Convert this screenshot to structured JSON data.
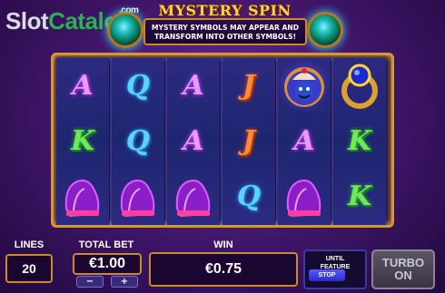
{
  "watermark": {
    "part1": "Slot",
    "part2": "Catalog",
    "suffix": ".com"
  },
  "header": {
    "title": "MYSTERY SPIN",
    "banner_line1": "MYSTERY SYMBOLS MAY APPEAR AND",
    "banner_line2": "TRANSFORM INTO OTHER SYMBOLS!"
  },
  "reels": [
    [
      {
        "t": "A",
        "c": "a"
      },
      {
        "t": "K",
        "c": "k"
      },
      {
        "t": "",
        "c": "scroll"
      }
    ],
    [
      {
        "t": "Q",
        "c": "q"
      },
      {
        "t": "Q",
        "c": "q"
      },
      {
        "t": "",
        "c": "scroll"
      }
    ],
    [
      {
        "t": "A",
        "c": "a"
      },
      {
        "t": "A",
        "c": "a"
      },
      {
        "t": "",
        "c": "scroll"
      }
    ],
    [
      {
        "t": "J",
        "c": "j"
      },
      {
        "t": "J",
        "c": "j"
      },
      {
        "t": "Q",
        "c": "q"
      }
    ],
    [
      {
        "t": "",
        "c": "genie"
      },
      {
        "t": "A",
        "c": "a"
      },
      {
        "t": "",
        "c": "scroll"
      }
    ],
    [
      {
        "t": "",
        "c": "ring"
      },
      {
        "t": "K",
        "c": "k"
      },
      {
        "t": "K",
        "c": "k"
      }
    ]
  ],
  "bottom": {
    "lines_label": "LINES",
    "lines_value": "20",
    "bet_label": "TOTAL BET",
    "bet_value": "€1.00",
    "minus": "−",
    "plus": "+",
    "win_label": "WIN",
    "win_value": "€0.75",
    "until_line1": "UNTIL",
    "until_line2": "FEATURE",
    "stop_label": "STOP",
    "turbo_line1": "TURBO",
    "turbo_line2": "ON"
  },
  "colors": {
    "frame": "#d8962e",
    "background": "#3d1466",
    "accent_gold": "#ffd23a"
  }
}
